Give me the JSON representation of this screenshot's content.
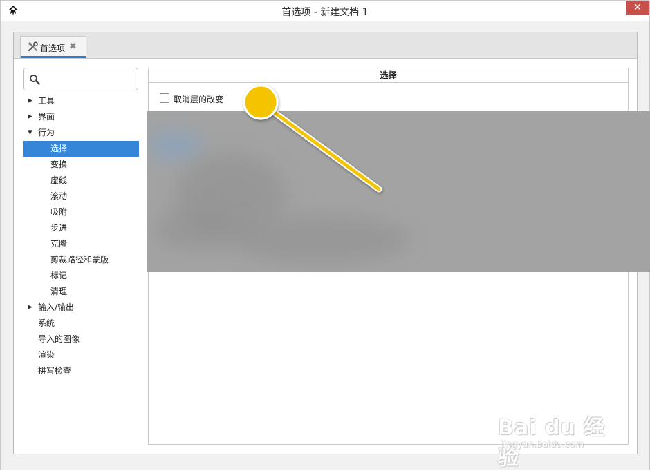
{
  "window": {
    "title": "首选项 - 新建文档 1",
    "close_glyph": "✕"
  },
  "tab": {
    "label": "首选项",
    "close_glyph": "✖"
  },
  "search": {
    "placeholder": "",
    "value": ""
  },
  "tree": {
    "items": [
      {
        "label": "工具",
        "level": 1,
        "arrow": "▶"
      },
      {
        "label": "界面",
        "level": 1,
        "arrow": "▶"
      },
      {
        "label": "行为",
        "level": 1,
        "arrow": "▼"
      },
      {
        "label": "选择",
        "level": 2,
        "selected": true
      },
      {
        "label": "变换",
        "level": 2
      },
      {
        "label": "虚线",
        "level": 2
      },
      {
        "label": "滚动",
        "level": 2
      },
      {
        "label": "吸附",
        "level": 2
      },
      {
        "label": "步进",
        "level": 2
      },
      {
        "label": "克隆",
        "level": 2
      },
      {
        "label": "剪裁路径和蒙版",
        "level": 2
      },
      {
        "label": "标记",
        "level": 2
      },
      {
        "label": "清理",
        "level": 2
      },
      {
        "label": "输入/输出",
        "level": 1,
        "arrow": "▶"
      },
      {
        "label": "系统",
        "level": 1
      },
      {
        "label": "导入的图像",
        "level": 1
      },
      {
        "label": "渲染",
        "level": 1
      },
      {
        "label": "拼写检查",
        "level": 1
      }
    ]
  },
  "panel": {
    "title": "选择",
    "checkbox_label": "取消层的改变",
    "checkbox_checked": false
  },
  "watermark": {
    "brand": "Bai du 经验",
    "url": "jingyan.baidu.com"
  },
  "colors": {
    "selection": "#3585d9",
    "accent_tab": "#2a7fd4",
    "close_button": "#c7504a",
    "annotation": "#f5c400"
  },
  "icons": {
    "app": "inkscape-icon",
    "tab": "tools-icon",
    "search": "search-icon"
  }
}
